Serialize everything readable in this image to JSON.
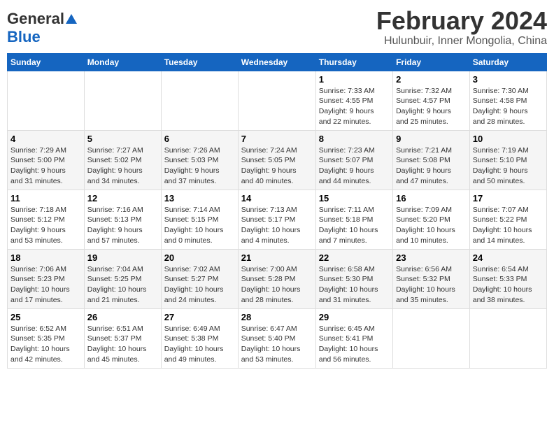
{
  "header": {
    "logo_general": "General",
    "logo_blue": "Blue",
    "title": "February 2024",
    "subtitle": "Hulunbuir, Inner Mongolia, China"
  },
  "days_of_week": [
    "Sunday",
    "Monday",
    "Tuesday",
    "Wednesday",
    "Thursday",
    "Friday",
    "Saturday"
  ],
  "weeks": [
    [
      {
        "day": "",
        "info": ""
      },
      {
        "day": "",
        "info": ""
      },
      {
        "day": "",
        "info": ""
      },
      {
        "day": "",
        "info": ""
      },
      {
        "day": "1",
        "info": "Sunrise: 7:33 AM\nSunset: 4:55 PM\nDaylight: 9 hours\nand 22 minutes."
      },
      {
        "day": "2",
        "info": "Sunrise: 7:32 AM\nSunset: 4:57 PM\nDaylight: 9 hours\nand 25 minutes."
      },
      {
        "day": "3",
        "info": "Sunrise: 7:30 AM\nSunset: 4:58 PM\nDaylight: 9 hours\nand 28 minutes."
      }
    ],
    [
      {
        "day": "4",
        "info": "Sunrise: 7:29 AM\nSunset: 5:00 PM\nDaylight: 9 hours\nand 31 minutes."
      },
      {
        "day": "5",
        "info": "Sunrise: 7:27 AM\nSunset: 5:02 PM\nDaylight: 9 hours\nand 34 minutes."
      },
      {
        "day": "6",
        "info": "Sunrise: 7:26 AM\nSunset: 5:03 PM\nDaylight: 9 hours\nand 37 minutes."
      },
      {
        "day": "7",
        "info": "Sunrise: 7:24 AM\nSunset: 5:05 PM\nDaylight: 9 hours\nand 40 minutes."
      },
      {
        "day": "8",
        "info": "Sunrise: 7:23 AM\nSunset: 5:07 PM\nDaylight: 9 hours\nand 44 minutes."
      },
      {
        "day": "9",
        "info": "Sunrise: 7:21 AM\nSunset: 5:08 PM\nDaylight: 9 hours\nand 47 minutes."
      },
      {
        "day": "10",
        "info": "Sunrise: 7:19 AM\nSunset: 5:10 PM\nDaylight: 9 hours\nand 50 minutes."
      }
    ],
    [
      {
        "day": "11",
        "info": "Sunrise: 7:18 AM\nSunset: 5:12 PM\nDaylight: 9 hours\nand 53 minutes."
      },
      {
        "day": "12",
        "info": "Sunrise: 7:16 AM\nSunset: 5:13 PM\nDaylight: 9 hours\nand 57 minutes."
      },
      {
        "day": "13",
        "info": "Sunrise: 7:14 AM\nSunset: 5:15 PM\nDaylight: 10 hours\nand 0 minutes."
      },
      {
        "day": "14",
        "info": "Sunrise: 7:13 AM\nSunset: 5:17 PM\nDaylight: 10 hours\nand 4 minutes."
      },
      {
        "day": "15",
        "info": "Sunrise: 7:11 AM\nSunset: 5:18 PM\nDaylight: 10 hours\nand 7 minutes."
      },
      {
        "day": "16",
        "info": "Sunrise: 7:09 AM\nSunset: 5:20 PM\nDaylight: 10 hours\nand 10 minutes."
      },
      {
        "day": "17",
        "info": "Sunrise: 7:07 AM\nSunset: 5:22 PM\nDaylight: 10 hours\nand 14 minutes."
      }
    ],
    [
      {
        "day": "18",
        "info": "Sunrise: 7:06 AM\nSunset: 5:23 PM\nDaylight: 10 hours\nand 17 minutes."
      },
      {
        "day": "19",
        "info": "Sunrise: 7:04 AM\nSunset: 5:25 PM\nDaylight: 10 hours\nand 21 minutes."
      },
      {
        "day": "20",
        "info": "Sunrise: 7:02 AM\nSunset: 5:27 PM\nDaylight: 10 hours\nand 24 minutes."
      },
      {
        "day": "21",
        "info": "Sunrise: 7:00 AM\nSunset: 5:28 PM\nDaylight: 10 hours\nand 28 minutes."
      },
      {
        "day": "22",
        "info": "Sunrise: 6:58 AM\nSunset: 5:30 PM\nDaylight: 10 hours\nand 31 minutes."
      },
      {
        "day": "23",
        "info": "Sunrise: 6:56 AM\nSunset: 5:32 PM\nDaylight: 10 hours\nand 35 minutes."
      },
      {
        "day": "24",
        "info": "Sunrise: 6:54 AM\nSunset: 5:33 PM\nDaylight: 10 hours\nand 38 minutes."
      }
    ],
    [
      {
        "day": "25",
        "info": "Sunrise: 6:52 AM\nSunset: 5:35 PM\nDaylight: 10 hours\nand 42 minutes."
      },
      {
        "day": "26",
        "info": "Sunrise: 6:51 AM\nSunset: 5:37 PM\nDaylight: 10 hours\nand 45 minutes."
      },
      {
        "day": "27",
        "info": "Sunrise: 6:49 AM\nSunset: 5:38 PM\nDaylight: 10 hours\nand 49 minutes."
      },
      {
        "day": "28",
        "info": "Sunrise: 6:47 AM\nSunset: 5:40 PM\nDaylight: 10 hours\nand 53 minutes."
      },
      {
        "day": "29",
        "info": "Sunrise: 6:45 AM\nSunset: 5:41 PM\nDaylight: 10 hours\nand 56 minutes."
      },
      {
        "day": "",
        "info": ""
      },
      {
        "day": "",
        "info": ""
      }
    ]
  ]
}
